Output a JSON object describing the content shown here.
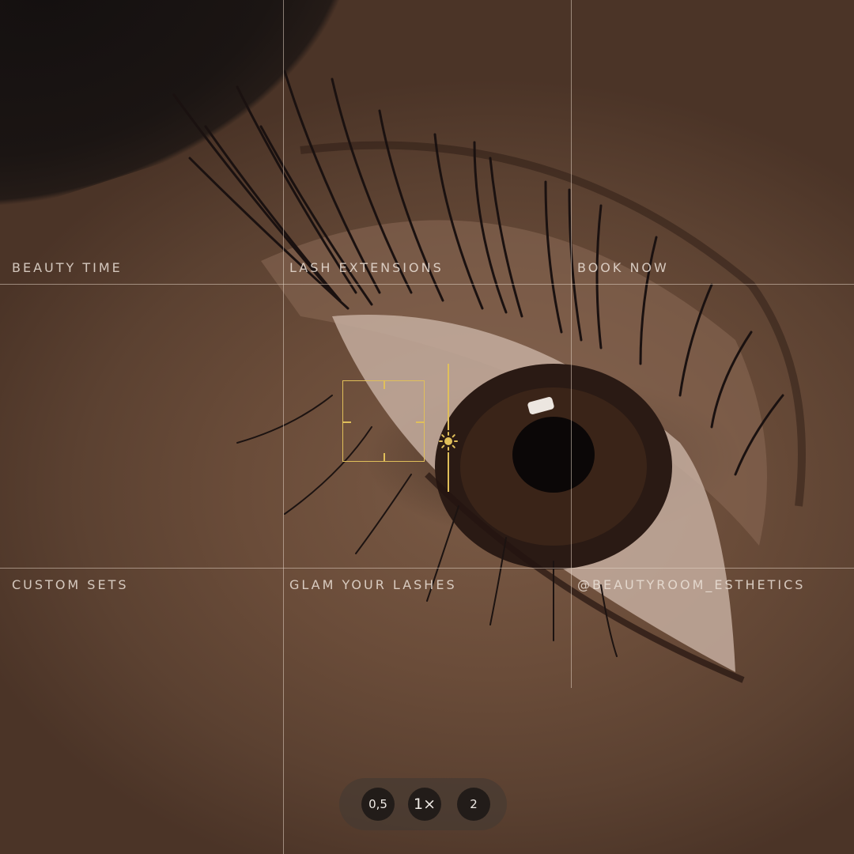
{
  "grid_labels": {
    "top_left": "BEAUTY TIME",
    "top_center": "LASH EXTENSIONS",
    "top_right": "BOOK NOW",
    "bottom_left": "CUSTOM SETS",
    "bottom_center": "GLAM YOUR LASHES",
    "bottom_right": "@BEAUTYROOM_ESTHETICS"
  },
  "camera": {
    "focus_icon": "focus-square-icon",
    "exposure_icon": "sun-icon",
    "accent_color": "#e0bf5a",
    "zoom_options": [
      "0,5",
      "1×",
      "2"
    ],
    "zoom_selected": "1×"
  }
}
